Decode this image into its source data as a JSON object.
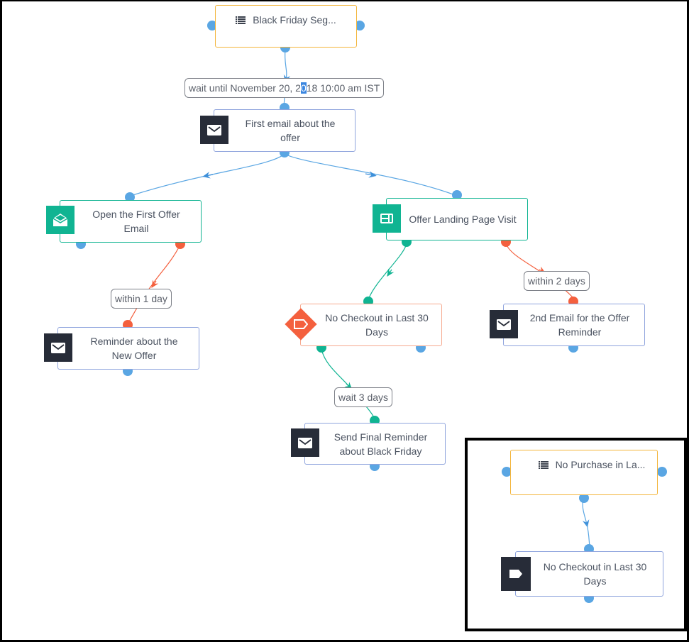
{
  "colors": {
    "connector_blue": "#5aa6e3",
    "connector_red": "#f4603e",
    "connector_green": "#10b492",
    "segment_border": "#f3b53b",
    "action_border": "#8fa4dd",
    "event_border": "#10b492",
    "condition_border": "#f6a98f",
    "dark_icon_bg": "#272c38",
    "teal_icon_bg": "#10b492"
  },
  "nodes": {
    "segment_black_friday": {
      "label": "Black Friday Seg...",
      "icon": "list-icon",
      "type": "segment"
    },
    "first_email": {
      "label": "First email about the offer",
      "icon": "mail-icon",
      "type": "action"
    },
    "open_first_offer": {
      "label": "Open the First Offer Email",
      "icon": "mail-open-icon",
      "type": "event"
    },
    "landing_page_visit": {
      "label": "Offer Landing Page Visit",
      "icon": "webpage-icon",
      "type": "event"
    },
    "reminder_new_offer": {
      "label": "Reminder about the New Offer",
      "icon": "mail-icon",
      "type": "action"
    },
    "no_checkout": {
      "label": "No Checkout in Last 30 Days",
      "icon": "tag-icon",
      "type": "condition"
    },
    "second_email": {
      "label": "2nd Email for the Offer Reminder",
      "icon": "mail-icon",
      "type": "action"
    },
    "final_reminder": {
      "label": "Send Final Reminder about Black Friday",
      "icon": "mail-icon",
      "type": "action"
    }
  },
  "edge_labels": {
    "wait_until": {
      "before": "wait until November 20, 2",
      "selected": "0",
      "after": "18 10:00 am IST"
    },
    "within_1_day": "within 1 day",
    "within_2_days": "within 2 days",
    "wait_3_days": "wait 3 days"
  },
  "inset": {
    "segment": {
      "label": "No Purchase in La...",
      "icon": "list-icon"
    },
    "condition": {
      "label": "No Checkout in Last 30 Days",
      "icon": "tag-icon"
    }
  }
}
